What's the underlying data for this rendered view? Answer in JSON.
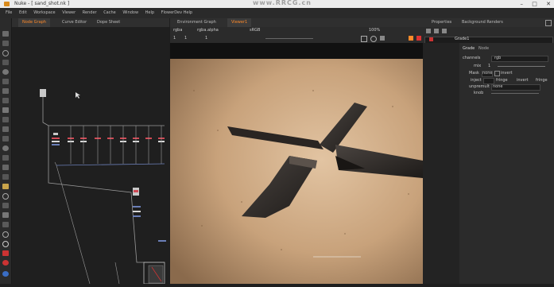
{
  "app": {
    "title": "Nuke - [ sand_shot.nk ]",
    "watermark": "www.RRCG.cn"
  },
  "menu": [
    "File",
    "Edit",
    "Workspace",
    "Viewer",
    "Render",
    "Cache",
    "Window",
    "Help",
    "FlowerDev Help"
  ],
  "left_tabs": [
    {
      "label": "Node Graph",
      "active": true
    },
    {
      "label": "Curve Editor",
      "active": false
    },
    {
      "label": "Dope Sheet",
      "active": false
    }
  ],
  "center_tabs": [
    {
      "label": "Environment Graph",
      "active": false
    },
    {
      "label": "Viewer1",
      "active": true
    }
  ],
  "right_tabs": [
    {
      "label": "Properties",
      "active": false
    },
    {
      "label": "Background Renders",
      "active": false
    }
  ],
  "viewer": {
    "channel": "rgba",
    "layer": "rgba.alpha",
    "colorspace": "sRGB",
    "zoom": "100%",
    "frame": "1",
    "inpoint_label": "1",
    "gain": "1",
    "gamma": "1"
  },
  "properties": {
    "node_name": "Grade1",
    "tabs": [
      "Grade",
      "Node"
    ],
    "rows": [
      {
        "label": "channels",
        "value": "rgb"
      },
      {
        "label": "mix",
        "value": "1"
      },
      {
        "label": "Mask",
        "value": "none"
      },
      {
        "label": "inject",
        "value": "",
        "opt1": "fringe",
        "opt2": "invert"
      },
      {
        "label": "unpremult",
        "value": "none"
      },
      {
        "label": "knob",
        "value": ""
      }
    ],
    "checkbox_label": "invert",
    "fringe_label": "fringe",
    "mix_label": "mix"
  },
  "colors": {
    "accent": "#ff8a2a",
    "panel": "#2b2b2b",
    "bg": "#1e1e1e"
  }
}
